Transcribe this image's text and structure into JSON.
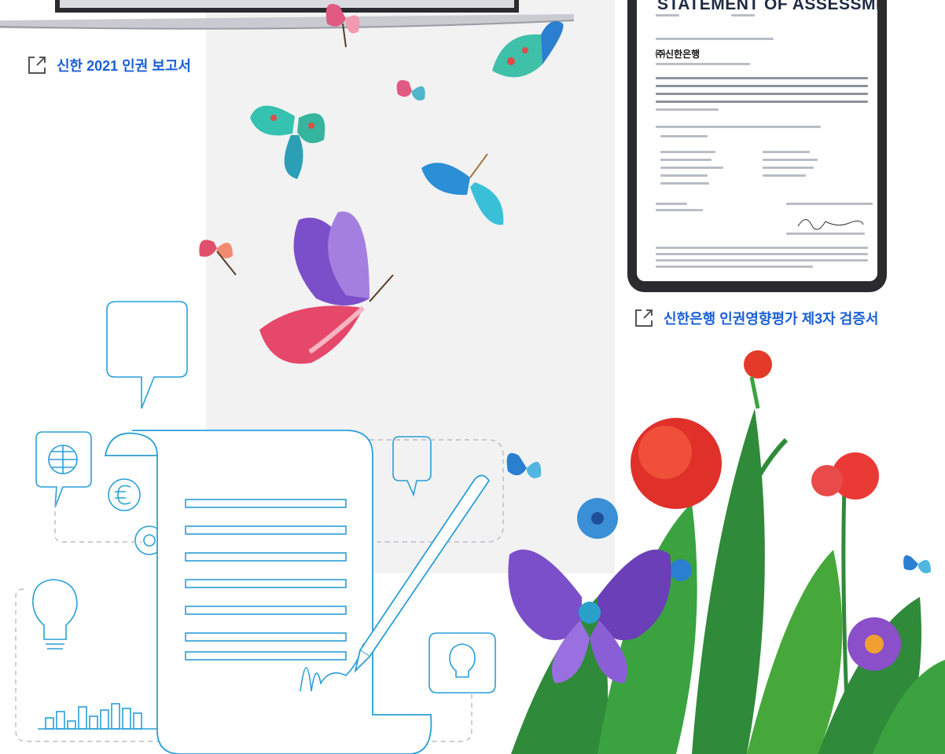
{
  "links": {
    "report": {
      "label": "신한 2021 인권 보고서",
      "icon": "external-link-icon"
    },
    "assessment": {
      "label": "신한은행 인권영향평가 제3자 검증서",
      "icon": "external-link-icon"
    }
  },
  "document": {
    "title": "STATEMENT OF ASSESSMENT",
    "company": "㈜신한은행"
  },
  "colors": {
    "link": "#1a5fd6",
    "panel": "#f2f2f3",
    "line_art": "#2a9fd8"
  }
}
